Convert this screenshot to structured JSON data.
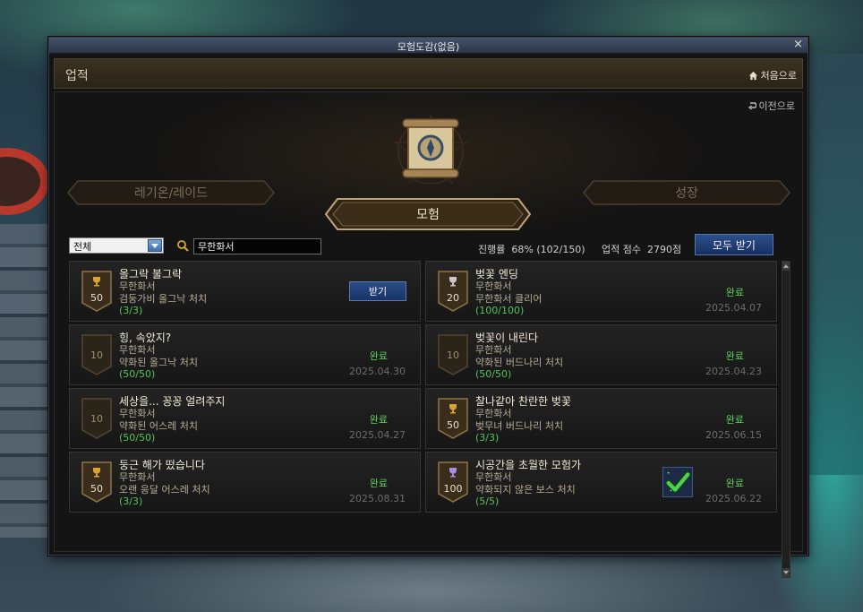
{
  "window": {
    "title": "모험도감(없음)",
    "close_glyph": "×"
  },
  "header": {
    "section_title": "업적",
    "home_label": "처음으로",
    "home_icon": "home-icon"
  },
  "back_label": "이전으로",
  "categories": {
    "left": "레기온/레이드",
    "active": "모험",
    "right": "성장"
  },
  "filter": {
    "dropdown_value": "전체",
    "search_value": "무한화서"
  },
  "summary": {
    "progress_label": "진행률",
    "progress_value": "68% (102/150)",
    "score_label": "업적 점수",
    "score_value": "2790점",
    "claim_all_label": "모두 받기"
  },
  "cards": [
    {
      "name": "올그락 불그락",
      "category": "무한화서",
      "desc": "검둥가비 올그낙 처치",
      "count": "(3/3)",
      "points": "50",
      "trophy": "gold",
      "status": "claim",
      "claim_label": "받기",
      "done_label": "",
      "date": ""
    },
    {
      "name": "벚꽃 엔딩",
      "category": "무한화서",
      "desc": "무한화서 클리어",
      "count": "(100/100)",
      "points": "20",
      "trophy": "silver",
      "status": "done",
      "claim_label": "",
      "done_label": "완료",
      "date": "2025.04.07"
    },
    {
      "name": "힝, 속았지?",
      "category": "무한화서",
      "desc": "약화된 올그낙 처치",
      "count": "(50/50)",
      "points": "10",
      "trophy": "none",
      "status": "done",
      "claim_label": "",
      "done_label": "완료",
      "date": "2025.04.30"
    },
    {
      "name": "벚꽃이 내린다",
      "category": "무한화서",
      "desc": "약화된 버드나리 처치",
      "count": "(50/50)",
      "points": "10",
      "trophy": "none",
      "status": "done",
      "claim_label": "",
      "done_label": "완료",
      "date": "2025.04.23"
    },
    {
      "name": "세상을... 꽁꽁 얼려주지",
      "category": "무한화서",
      "desc": "약화된 어스레 처치",
      "count": "(50/50)",
      "points": "10",
      "trophy": "none",
      "status": "done",
      "claim_label": "",
      "done_label": "완료",
      "date": "2025.04.27"
    },
    {
      "name": "찰나같아 찬란한 벚꽃",
      "category": "무한화서",
      "desc": "벚무녀 버드나리 처치",
      "count": "(3/3)",
      "points": "50",
      "trophy": "gold",
      "status": "done",
      "claim_label": "",
      "done_label": "완료",
      "date": "2025.06.15"
    },
    {
      "name": "둥근 해가 떴습니다",
      "category": "무한화서",
      "desc": "오랜 응달 어스레 처치",
      "count": "(3/3)",
      "points": "50",
      "trophy": "gold",
      "status": "done",
      "claim_label": "",
      "done_label": "완료",
      "date": "2025.08.31"
    },
    {
      "name": "시공간을 초월한 모험가",
      "category": "무한화서",
      "desc": "약화되지 않은 보스 처치",
      "count": "(5/5)",
      "points": "100",
      "trophy": "purple",
      "status": "done",
      "claim_label": "",
      "done_label": "완료",
      "date": "2025.06.22",
      "reward_icon": "checkmark-reward-icon"
    }
  ],
  "colors": {
    "accent_blue": "#2b4d88",
    "complete_green": "#5ed05e",
    "trophy_gold": "#d9a531",
    "trophy_silver": "#c9c9c9",
    "trophy_purple": "#a98be0"
  }
}
